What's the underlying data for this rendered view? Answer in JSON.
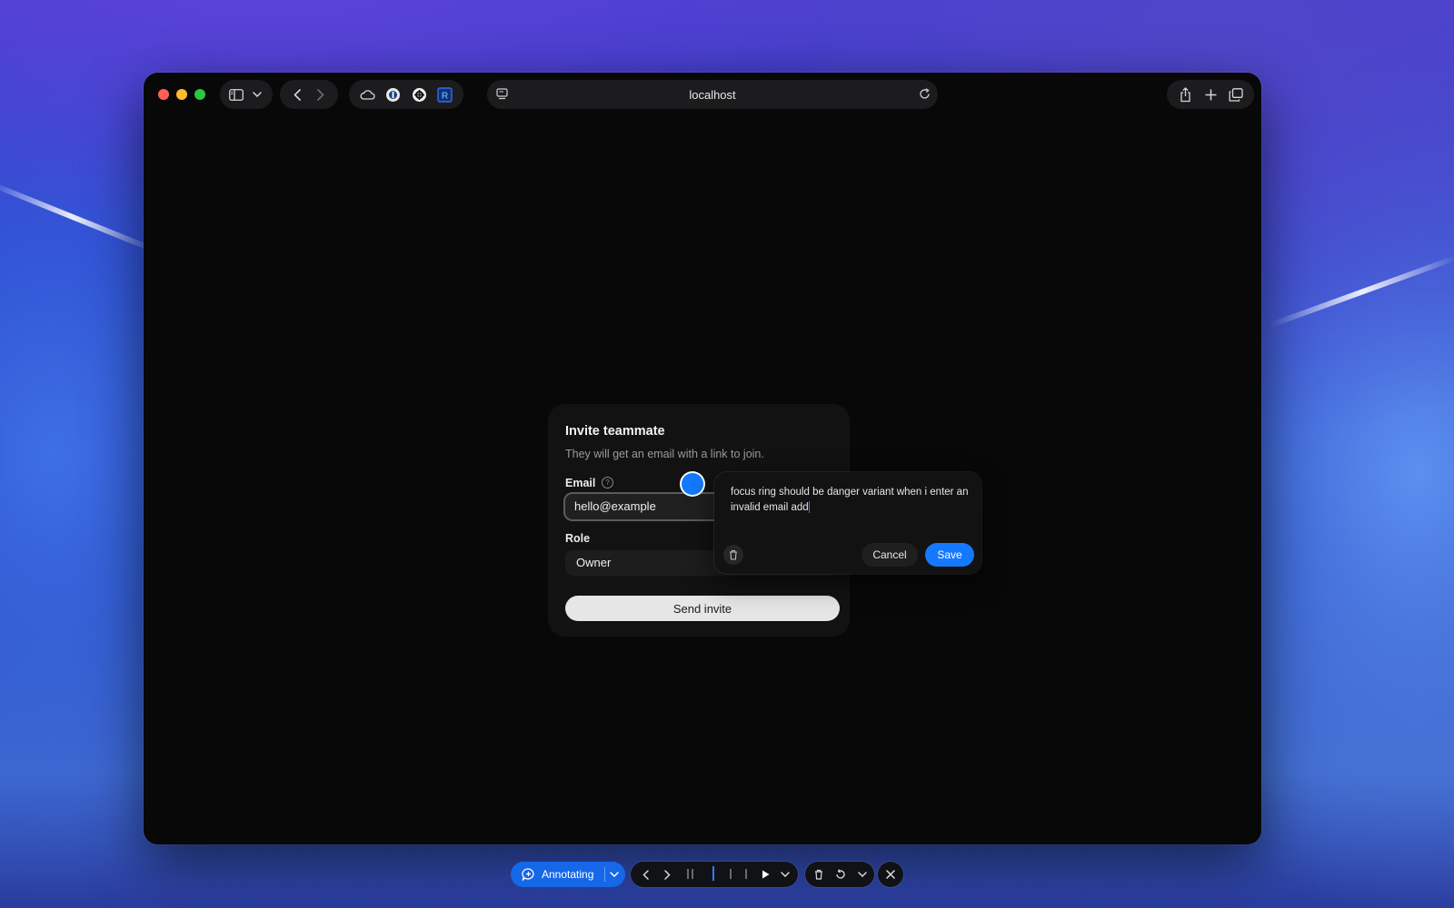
{
  "browser": {
    "address": "localhost"
  },
  "card": {
    "title": "Invite teammate",
    "subtitle": "They will get an email with a link to join.",
    "email_label": "Email",
    "email_help": "?",
    "email_value": "hello@example",
    "role_label": "Role",
    "role_value": "Owner",
    "send_label": "Send invite"
  },
  "annotation": {
    "note_text": "focus ring should be danger variant when i enter an invalid email add",
    "cancel_label": "Cancel",
    "save_label": "Save"
  },
  "annotation_toolbar": {
    "mode_label": "Annotating"
  },
  "colors": {
    "accent": "#1479ff",
    "card_bg": "#121212",
    "page_bg": "#080808"
  }
}
